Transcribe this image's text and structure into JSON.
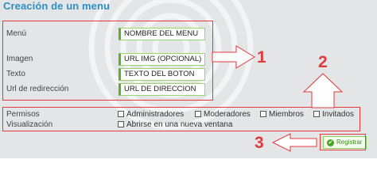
{
  "title": "Creación de un menu",
  "labels": {
    "menu": "Menú",
    "imagen": "Imagen",
    "texto": "Texto",
    "url": "Url de redirección",
    "permisos": "Permisos",
    "visualizacion": "Visualización"
  },
  "fields": {
    "nombre": "NOMBRE DEL MENU",
    "imagen": "URL IMG (OPCIONAL)",
    "texto": "TEXTO DEL BOTON",
    "url": "URL DE DIRECCION"
  },
  "permisos": [
    {
      "label": "Administradores",
      "checked": false
    },
    {
      "label": "Moderadores",
      "checked": false
    },
    {
      "label": "Miembros",
      "checked": false
    },
    {
      "label": "Invitados",
      "checked": false
    }
  ],
  "visualizacion": {
    "label": "Abrirse en una nueva ventana",
    "checked": false
  },
  "register_button": "Registrar",
  "annotations": [
    "1",
    "2",
    "3"
  ],
  "colors": {
    "title": "#2f8fc4",
    "accent_red": "#e23a3a",
    "field_border": "#5eaf2a"
  }
}
